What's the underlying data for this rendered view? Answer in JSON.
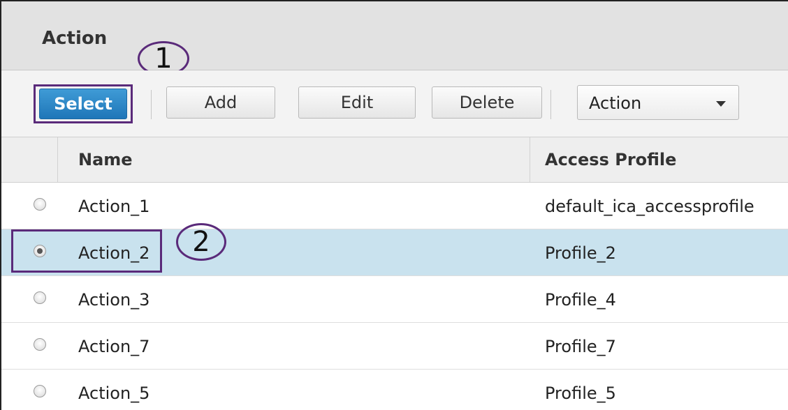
{
  "panel": {
    "title": "Action"
  },
  "callouts": [
    "1",
    "2"
  ],
  "toolbar": {
    "select_label": "Select",
    "add_label": "Add",
    "edit_label": "Edit",
    "delete_label": "Delete",
    "dropdown_value": "Action"
  },
  "table": {
    "columns": [
      "Name",
      "Access Profile"
    ],
    "rows": [
      {
        "name": "Action_1",
        "profile": "default_ica_accessprofile",
        "selected": false
      },
      {
        "name": "Action_2",
        "profile": "Profile_2",
        "selected": true
      },
      {
        "name": "Action_3",
        "profile": "Profile_4",
        "selected": false
      },
      {
        "name": "Action_7",
        "profile": "Profile_7",
        "selected": false
      },
      {
        "name": "Action_5",
        "profile": "Profile_5",
        "selected": false
      }
    ]
  },
  "colors": {
    "select_button": "#1f76b8",
    "selected_row": "#c9e2ee",
    "callout_outline": "#5a2a7a"
  }
}
